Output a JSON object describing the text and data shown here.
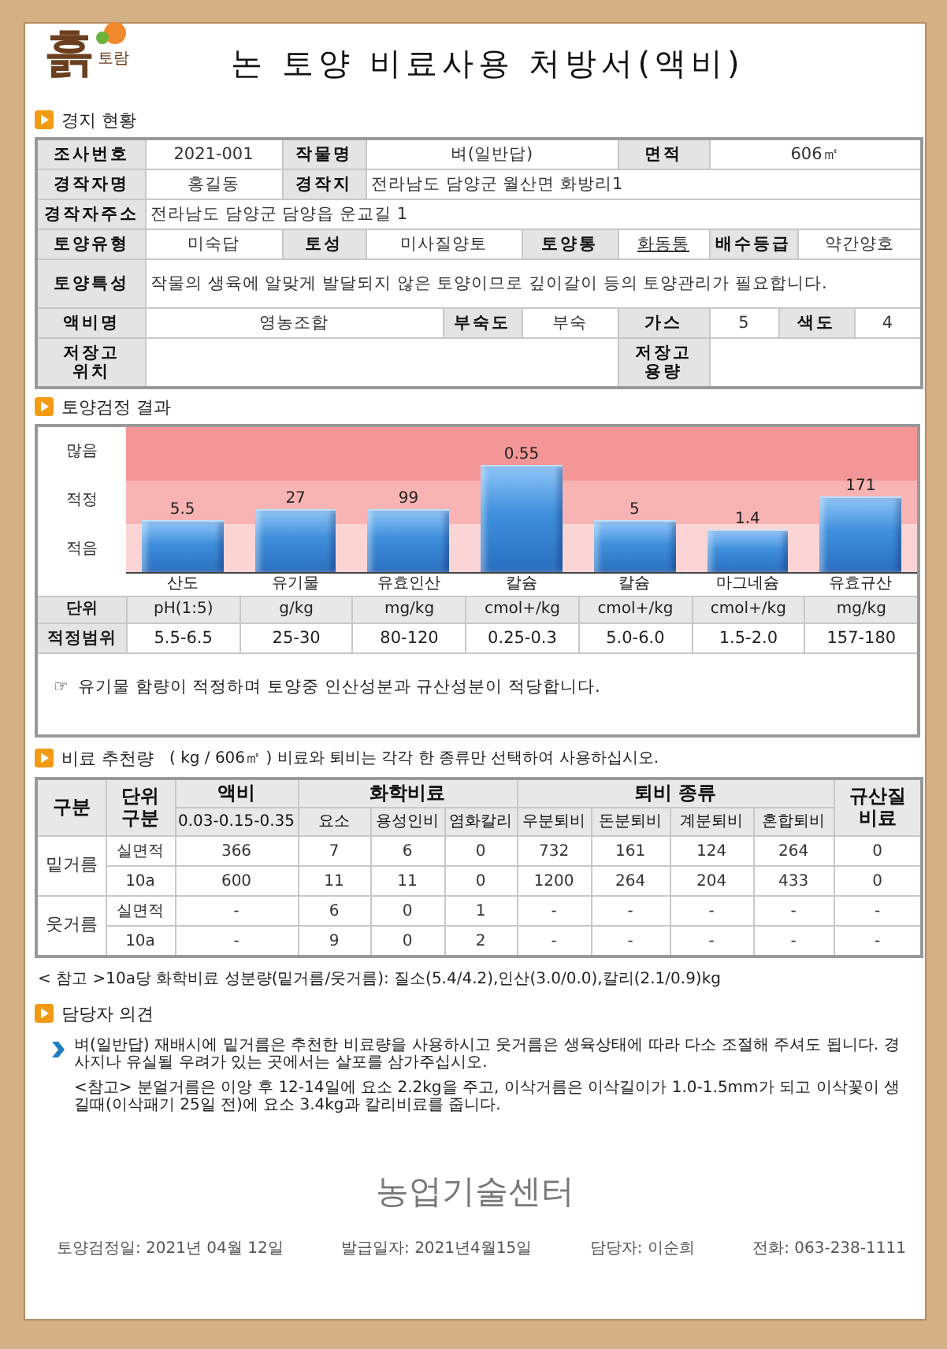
{
  "header": {
    "logo_main": "흙",
    "logo_sub": "토람",
    "title": "논 토양 비료사용 처방서(액비)"
  },
  "field_status": {
    "heading": "경지 현황",
    "rows": [
      [
        {
          "label": "조사번호",
          "value": "2021-001"
        },
        {
          "label": "작물명",
          "value": "벼(일반답)"
        },
        {
          "label": "면적",
          "value": "606㎡"
        }
      ],
      [
        {
          "label": "경작자명",
          "value": "홍길동"
        },
        {
          "label": "경작지",
          "value": "전라남도 담양군 월산면 화방리1"
        }
      ],
      [
        {
          "label": "경작자주소",
          "value": "전라남도 담양군 담양읍 운교길 1"
        }
      ],
      [
        {
          "label": "토양유형",
          "value": "미숙답"
        },
        {
          "label": "토성",
          "value": "미사질양토"
        },
        {
          "label": "토양통",
          "value": "화동통",
          "kind": "link"
        },
        {
          "label": "배수등급",
          "value": "약간양호"
        }
      ],
      [
        {
          "label": "토양특성",
          "value": "작물의 생육에 알맞게 발달되지 않은 토양이므로 깊이갈이 등의 토양관리가 필요합니다."
        }
      ],
      [
        {
          "label": "액비명",
          "value": "영농조합"
        },
        {
          "label": "부숙도",
          "value": "부숙"
        },
        {
          "label": "가스",
          "value": "5"
        },
        {
          "label": "색도",
          "value": "4"
        }
      ],
      [
        {
          "label": "저장고\n위치"
        },
        {},
        {
          "label": "저장고\n용량"
        }
      ]
    ]
  },
  "soil_test": {
    "heading": "토양검정 결과",
    "bands": [
      "많음",
      "적정",
      "적음"
    ],
    "bars": [
      {
        "name": "산도",
        "reading": "5.5",
        "level": 0.36
      },
      {
        "name": "유기물",
        "reading": "27",
        "level": 0.44
      },
      {
        "name": "유효인산",
        "reading": "99",
        "level": 0.44
      },
      {
        "name": "칼슘",
        "reading": "0.55",
        "level": 0.74
      },
      {
        "name": "칼슘",
        "reading": "5",
        "level": 0.36
      },
      {
        "name": "마그네슘",
        "reading": "1.4",
        "level": 0.29
      },
      {
        "name": "유효규산",
        "reading": "171",
        "level": 0.52
      }
    ],
    "unit_label": "단위",
    "units": [
      "pH(1:5)",
      "g/kg",
      "mg/kg",
      "cmol+/kg",
      "cmol+/kg",
      "cmol+/kg",
      "mg/kg"
    ],
    "range_label": "적정범위",
    "ranges": [
      "5.5-6.5",
      "25-30",
      "80-120",
      "0.25-0.3",
      "5.0-6.0",
      "1.5-2.0",
      "157-180"
    ],
    "note_mark": "☞",
    "note": "유기물 함량이 적정하며 토양중 인산성분과 규산성분이 적당합니다."
  },
  "fertilizer": {
    "heading": "비료 추천량",
    "unit_note": "( kg / 606㎡ ) 비료와 퇴비는 각각 한 종류만 선택하여 사용하십시오.",
    "category_header": "구분",
    "unit_header": "단위\n구분",
    "silicate_header": "규산질\n비료",
    "groups": [
      {
        "title": "액비",
        "columns": [
          "0.03-0.15-0.35"
        ]
      },
      {
        "title": "화학비료",
        "columns": [
          "요소",
          "용성인비",
          "염화칼리"
        ]
      },
      {
        "title": "퇴비 종류",
        "columns": [
          "우분퇴비",
          "돈분퇴비",
          "계분퇴비",
          "혼합퇴비"
        ]
      }
    ],
    "rows": [
      {
        "group": "밑거름",
        "lines": [
          {
            "unit": "실면적",
            "values": [
              "366",
              "7",
              "6",
              "0",
              "732",
              "161",
              "124",
              "264",
              "0"
            ]
          },
          {
            "unit": "10a",
            "values": [
              "600",
              "11",
              "11",
              "0",
              "1200",
              "264",
              "204",
              "433",
              "0"
            ]
          }
        ]
      },
      {
        "group": "웃거름",
        "lines": [
          {
            "unit": "실면적",
            "values": [
              "-",
              "6",
              "0",
              "1",
              "-",
              "-",
              "-",
              "-",
              "-"
            ]
          },
          {
            "unit": "10a",
            "values": [
              "-",
              "9",
              "0",
              "2",
              "-",
              "-",
              "-",
              "-",
              "-"
            ]
          }
        ]
      }
    ],
    "note": "< 참고 >10a당 화학비료 성분량(밑거름/웃거름): 질소(5.4/4.2),인산(3.0/0.0),칼리(2.1/0.9)kg"
  },
  "opinion": {
    "heading": "담당자 의견",
    "items": [
      {
        "kind": "bullet",
        "text": "벼(일반답) 재배시에 밑거름은 추천한 비료량을 사용하시고 웃거름은 생육상태에 따라 다소 조절해 주셔도 됩니다. 경사지나 유실될 우려가 있는 곳에서는 살포를 삼가주십시오."
      },
      {
        "kind": "plain",
        "text": "<참고> 분얼거름은 이앙 후 12-14일에 요소 2.2kg을 주고, 이삭거름은 이삭길이가 1.0-1.5mm가 되고 이삭꽃이 생길때(이삭패기 25일 전)에 요소 3.4kg과 칼리비료를 줍니다."
      }
    ]
  },
  "issuer": "농업기술센터",
  "footer": [
    "토양검정일: 2021년 04월 12일",
    "발급일자: 2021년4월15일",
    "담당자: 이순희",
    "전화: 063-238-1111"
  ]
}
